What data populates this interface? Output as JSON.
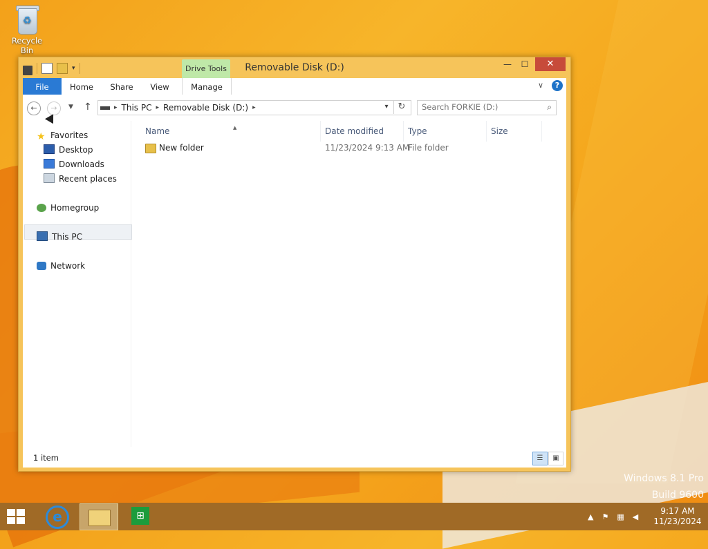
{
  "desktop": {
    "icons": [
      {
        "label": "Recycle Bin",
        "icon": "recycle-bin-icon"
      }
    ],
    "watermark": [
      "Windows 8.1 Pro",
      "Build 9600"
    ]
  },
  "window": {
    "title": "Removable Disk (D:)",
    "context_tab": "Drive Tools",
    "controls": {
      "minimize": "—",
      "maximize": "☐",
      "close": "✕"
    },
    "ribbon_tabs": [
      "File",
      "Home",
      "Share",
      "View",
      "Manage"
    ],
    "nav": {
      "back": "←",
      "forward": "→",
      "recent": "▼",
      "up": "↑",
      "breadcrumb": [
        "This PC",
        "Removable Disk (D:)"
      ],
      "breadcrumb_sep": "▸",
      "address_dropdown": "▾",
      "refresh": "↻",
      "search_placeholder": "Search FORKIE (D:)",
      "search_icon": "⌕"
    },
    "navpane": {
      "favorites_label": "Favorites",
      "favorites": [
        "Desktop",
        "Downloads",
        "Recent places"
      ],
      "homegroup": "Homegroup",
      "this_pc": "This PC",
      "network": "Network"
    },
    "columns": [
      "Name",
      "Date modified",
      "Type",
      "Size"
    ],
    "files": [
      {
        "name": "New folder",
        "date_modified": "11/23/2024 9:13 AM",
        "type": "File folder",
        "size": ""
      }
    ],
    "status": {
      "item_count": "1 item"
    }
  },
  "taskbar": {
    "pinned": [
      "start-button",
      "internet-explorer",
      "file-explorer",
      "store"
    ],
    "tray_icons": [
      "show-hidden-icons",
      "action-center-flag",
      "network-icon",
      "volume-muted-icon"
    ],
    "tray_glyphs": {
      "show_hidden": "▲",
      "flag": "⚑",
      "network": "▦",
      "volume": "◀"
    },
    "time": "9:17 AM",
    "date": "11/23/2024"
  },
  "colors": {
    "accent_file_tab": "#2a7ad4",
    "context_tab": "#bfe8a8",
    "close_button": "#c74b3a",
    "window_frame": "#f6c45a"
  }
}
